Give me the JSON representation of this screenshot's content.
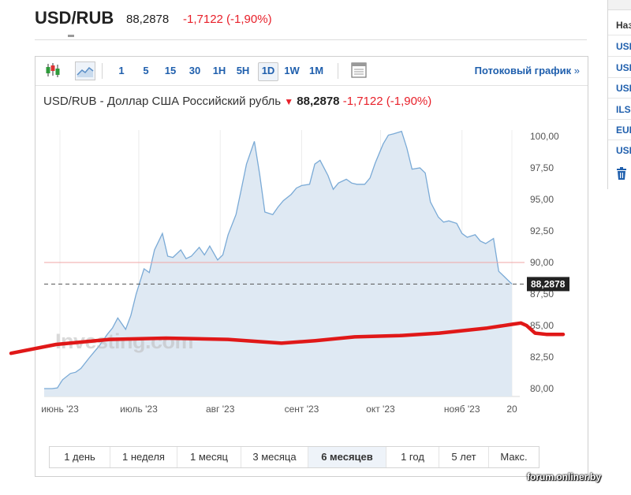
{
  "header": {
    "title": "USD/RUB",
    "price": "88,2878",
    "change": "-1,7122",
    "change_pct": "(-1,90%)"
  },
  "toolbar": {
    "icons": [
      "candlestick-icon",
      "area-chart-icon",
      "calendar-icon"
    ],
    "intervals": [
      "1",
      "5",
      "15",
      "30",
      "1H",
      "5H",
      "1D",
      "1W",
      "1M"
    ],
    "active_interval": "1D",
    "stream_label": "Потоковый график",
    "stream_arrow": "»"
  },
  "chart_title": {
    "pair": "USD/RUB - Доллар США Российский рубль",
    "price": "88,2878",
    "change": "-1,7122",
    "change_pct": "(-1,90%)"
  },
  "watermark": "Investing.com",
  "ranges": [
    "1 день",
    "1 неделя",
    "1 месяц",
    "3 месяца",
    "6 месяцев",
    "1 год",
    "5 лет",
    "Макс."
  ],
  "active_range": "6 месяцев",
  "right_panel": {
    "lines": [
      "Наз",
      "USD",
      "USD",
      "USD",
      "ILS",
      "EUR",
      "USD"
    ],
    "icon": "trash-icon"
  },
  "site_watermark": "forum.onliner.by",
  "colors": {
    "accent": "#1f5fad",
    "negative": "#e8202a",
    "line": "#7aaad6",
    "area": "#dfe9f3",
    "overlay": "#e01818"
  },
  "chart_data": {
    "type": "area",
    "x_tick_labels": [
      "июнь '23",
      "июль '23",
      "авг '23",
      "сент '23",
      "окт '23",
      "нояб '23",
      "20"
    ],
    "y_tick_labels": [
      "80,00",
      "82,50",
      "85,00",
      "87,50",
      "90,00",
      "92,50",
      "95,00",
      "97,50",
      "100,00"
    ],
    "ylim": [
      79.5,
      101
    ],
    "current_value": 88.2878,
    "current_label": "88,2878",
    "reference_level": 90.0,
    "grid": "vertical",
    "points": [
      [
        "2023-05-26",
        80.0
      ],
      [
        "2023-05-29",
        80.0
      ],
      [
        "2023-05-31",
        80.05
      ],
      [
        "2023-06-02",
        80.7
      ],
      [
        "2023-06-05",
        81.2
      ],
      [
        "2023-06-07",
        81.3
      ],
      [
        "2023-06-09",
        81.6
      ],
      [
        "2023-06-12",
        82.4
      ],
      [
        "2023-06-14",
        82.9
      ],
      [
        "2023-06-16",
        83.4
      ],
      [
        "2023-06-19",
        84.3
      ],
      [
        "2023-06-21",
        84.8
      ],
      [
        "2023-06-23",
        85.6
      ],
      [
        "2023-06-26",
        84.7
      ],
      [
        "2023-06-28",
        85.8
      ],
      [
        "2023-06-30",
        87.5
      ],
      [
        "2023-07-03",
        89.5
      ],
      [
        "2023-07-05",
        89.2
      ],
      [
        "2023-07-07",
        91.0
      ],
      [
        "2023-07-10",
        92.3
      ],
      [
        "2023-07-12",
        90.5
      ],
      [
        "2023-07-14",
        90.4
      ],
      [
        "2023-07-17",
        91.0
      ],
      [
        "2023-07-19",
        90.3
      ],
      [
        "2023-07-21",
        90.5
      ],
      [
        "2023-07-24",
        91.2
      ],
      [
        "2023-07-26",
        90.6
      ],
      [
        "2023-07-28",
        91.3
      ],
      [
        "2023-07-31",
        90.2
      ],
      [
        "2023-08-02",
        90.6
      ],
      [
        "2023-08-04",
        92.2
      ],
      [
        "2023-08-07",
        93.8
      ],
      [
        "2023-08-09",
        95.8
      ],
      [
        "2023-08-11",
        97.8
      ],
      [
        "2023-08-14",
        99.6
      ],
      [
        "2023-08-16",
        97.0
      ],
      [
        "2023-08-18",
        94.0
      ],
      [
        "2023-08-21",
        93.8
      ],
      [
        "2023-08-23",
        94.4
      ],
      [
        "2023-08-25",
        94.9
      ],
      [
        "2023-08-28",
        95.4
      ],
      [
        "2023-08-30",
        95.9
      ],
      [
        "2023-09-01",
        96.1
      ],
      [
        "2023-09-04",
        96.2
      ],
      [
        "2023-09-06",
        97.8
      ],
      [
        "2023-09-08",
        98.1
      ],
      [
        "2023-09-11",
        96.9
      ],
      [
        "2023-09-13",
        95.8
      ],
      [
        "2023-09-15",
        96.3
      ],
      [
        "2023-09-18",
        96.6
      ],
      [
        "2023-09-20",
        96.3
      ],
      [
        "2023-09-22",
        96.2
      ],
      [
        "2023-09-25",
        96.2
      ],
      [
        "2023-09-27",
        96.7
      ],
      [
        "2023-09-29",
        97.9
      ],
      [
        "2023-10-02",
        99.4
      ],
      [
        "2023-10-04",
        100.1
      ],
      [
        "2023-10-06",
        100.2
      ],
      [
        "2023-10-09",
        100.4
      ],
      [
        "2023-10-11",
        99.1
      ],
      [
        "2023-10-13",
        97.4
      ],
      [
        "2023-10-16",
        97.5
      ],
      [
        "2023-10-18",
        97.1
      ],
      [
        "2023-10-20",
        94.8
      ],
      [
        "2023-10-23",
        93.6
      ],
      [
        "2023-10-25",
        93.2
      ],
      [
        "2023-10-27",
        93.3
      ],
      [
        "2023-10-30",
        93.1
      ],
      [
        "2023-11-01",
        92.3
      ],
      [
        "2023-11-03",
        92.0
      ],
      [
        "2023-11-06",
        92.2
      ],
      [
        "2023-11-08",
        91.7
      ],
      [
        "2023-11-10",
        91.5
      ],
      [
        "2023-11-13",
        91.9
      ],
      [
        "2023-11-15",
        89.3
      ],
      [
        "2023-11-17",
        88.9
      ],
      [
        "2023-11-20",
        88.2878
      ]
    ],
    "overlay_annotation": {
      "type": "hand-drawn line",
      "points": [
        [
          "2023-05-16",
          82.8
        ],
        [
          "2023-06-01",
          83.5
        ],
        [
          "2023-06-20",
          83.9
        ],
        [
          "2023-07-10",
          84.0
        ],
        [
          "2023-08-01",
          83.9
        ],
        [
          "2023-08-20",
          83.6
        ],
        [
          "2023-09-01",
          83.8
        ],
        [
          "2023-09-15",
          84.1
        ],
        [
          "2023-10-01",
          84.2
        ],
        [
          "2023-10-15",
          84.4
        ],
        [
          "2023-11-01",
          84.8
        ],
        [
          "2023-11-10",
          85.1
        ],
        [
          "2023-11-13",
          85.2
        ],
        [
          "2023-11-15",
          85.0
        ],
        [
          "2023-11-18",
          84.4
        ],
        [
          "2023-11-22",
          84.3
        ],
        [
          "2023-11-28",
          84.3
        ]
      ]
    }
  }
}
